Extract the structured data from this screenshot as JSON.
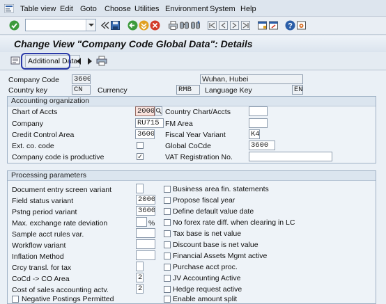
{
  "menu": {
    "items": [
      {
        "label": "Table view"
      },
      {
        "label": "Edit"
      },
      {
        "label": "Goto"
      },
      {
        "label": "Choose"
      },
      {
        "label": "Utilities"
      },
      {
        "label": "Environment"
      },
      {
        "label": "System"
      },
      {
        "label": "Help"
      }
    ]
  },
  "toolbar": {
    "command_field_value": "",
    "icons": [
      "enter-icon",
      "back-arrows-icon",
      "save-icon",
      "back-icon",
      "exit-icon",
      "cancel-icon",
      "print-icon",
      "find-icon",
      "find-next-icon",
      "first-page-icon",
      "previous-page-icon",
      "next-page-icon",
      "last-page-icon",
      "create-session-icon",
      "shortcut-icon",
      "help-icon",
      "customize-layout-icon"
    ]
  },
  "title": "Change View \"Company Code Global Data\": Details",
  "app_toolbar": {
    "additional_data_label": "Additional Data"
  },
  "header": {
    "company_code_label": "Company Code",
    "company_code_value": "3600",
    "city_value": "Wuhan, Hubei",
    "country_key_label": "Country key",
    "country_key_value": "CN",
    "currency_label": "Currency",
    "currency_value": "RMB",
    "language_key_label": "Language Key",
    "language_key_value": "EN"
  },
  "accounting_org": {
    "title": "Accounting organization",
    "chart_of_accts_label": "Chart of Accts",
    "chart_of_accts_value": "2000",
    "country_chart_label": "Country Chart/Accts",
    "country_chart_value": "",
    "company_label": "Company",
    "company_value": "RU715",
    "fm_area_label": "FM Area",
    "fm_area_value": "",
    "credit_control_label": "Credit Control Area",
    "credit_control_value": "3600",
    "fiscal_year_variant_label": "Fiscal Year Variant",
    "fiscal_year_variant_value": "K4",
    "ext_co_code_label": "Ext. co. code",
    "ext_co_code_checked": false,
    "global_cocde_label": "Global CoCde",
    "global_cocde_value": "3600",
    "productive_label": "Company code is productive",
    "productive_checked": true,
    "vat_reg_label": "VAT Registration No.",
    "vat_reg_value": ""
  },
  "processing": {
    "title": "Processing parameters",
    "left": [
      {
        "label": "Document entry screen variant",
        "value": ""
      },
      {
        "label": "Field status variant",
        "value": "2000"
      },
      {
        "label": "Pstng period variant",
        "value": "3600"
      },
      {
        "label": "Max. exchange rate deviation",
        "value": "",
        "unit": "%"
      },
      {
        "label": "Sample acct rules var.",
        "value": ""
      },
      {
        "label": "Workflow variant",
        "value": ""
      },
      {
        "label": "Inflation Method",
        "value": ""
      },
      {
        "label": "Crcy transl. for tax",
        "value": ""
      },
      {
        "label": "CoCd -> CO Area",
        "value": "2"
      },
      {
        "label": "Cost of sales accounting actv.",
        "value": "2"
      },
      {
        "label": "Negative Postings Permitted",
        "checked": false
      }
    ],
    "right": [
      {
        "label": "Business area fin. statements",
        "checked": false
      },
      {
        "label": "Propose fiscal year",
        "checked": false
      },
      {
        "label": "Define default value date",
        "checked": false
      },
      {
        "label": "No forex rate diff. when clearing in LC",
        "checked": false
      },
      {
        "label": "Tax base is net value",
        "checked": false
      },
      {
        "label": "Discount base is net value",
        "checked": false
      },
      {
        "label": "Financial Assets Mgmt active",
        "checked": false
      },
      {
        "label": "Purchase acct proc.",
        "checked": false
      },
      {
        "label": "JV Accounting Active",
        "checked": false
      },
      {
        "label": "Hedge request active",
        "checked": false
      },
      {
        "label": "Enable amount split",
        "checked": false
      }
    ]
  }
}
